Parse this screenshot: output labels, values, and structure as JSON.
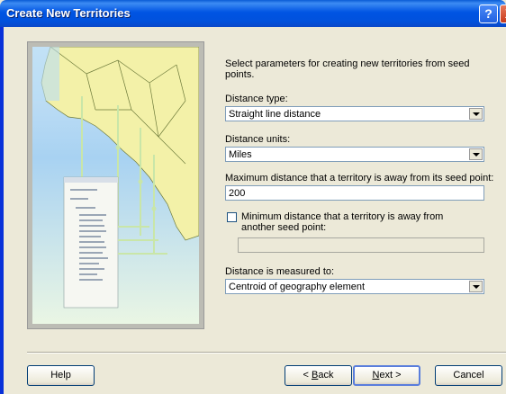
{
  "window": {
    "title": "Create New Territories",
    "help_glyph": "?",
    "close_glyph": "X"
  },
  "form": {
    "intro": "Select parameters for creating new territories from seed points.",
    "distance_type_label": "Distance type:",
    "distance_type_value": "Straight line distance",
    "distance_units_label": "Distance units:",
    "distance_units_value": "Miles",
    "max_distance_label": "Maximum distance that a territory is away  from its seed point:",
    "max_distance_value": "200",
    "min_distance_label": "Minimum distance that a territory is away from another seed point:",
    "min_distance_checked": false,
    "min_distance_value": "",
    "measured_to_label": "Distance is measured to:",
    "measured_to_value": "Centroid of geography element"
  },
  "buttons": {
    "help": "Help",
    "back_prefix": "< ",
    "back_accel": "B",
    "back_rest": "ack",
    "next_accel": "N",
    "next_rest": "ext >",
    "cancel": "Cancel"
  },
  "colors": {
    "title_bar": "#0054e3",
    "dialog_bg": "#ece9d8",
    "input_border": "#7f9db9",
    "map_land": "#f3f1a8",
    "map_water": "#a8d2f2"
  }
}
